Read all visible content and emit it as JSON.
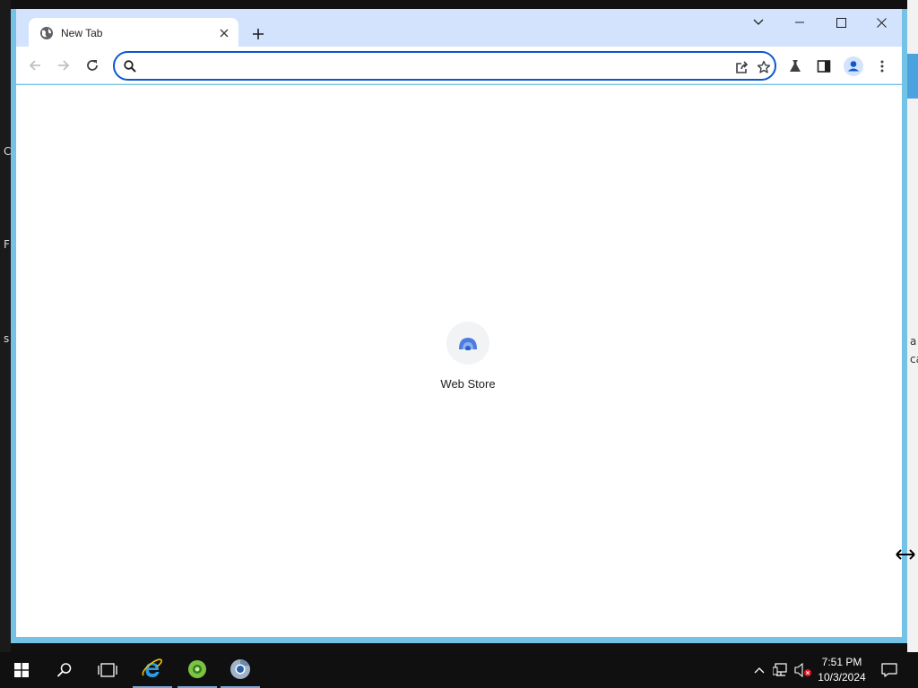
{
  "background": {
    "left_letters": [
      "C",
      "F",
      "s"
    ],
    "right_letters": [
      "a",
      "ca"
    ]
  },
  "browser": {
    "tab": {
      "title": "New Tab",
      "icon": "globe-icon"
    },
    "window_controls": [
      "tab-search",
      "minimize",
      "maximize",
      "close"
    ],
    "omnibox": {
      "value": "",
      "placeholder": ""
    },
    "accent_color": "#0b57d0",
    "titlebar_color": "#d3e3fd",
    "window_border_color": "#74c3e6"
  },
  "new_tab_page": {
    "shortcuts": [
      {
        "label": "Web Store",
        "icon": "web-store-icon"
      }
    ]
  },
  "taskbar": {
    "apps": [
      "start",
      "search",
      "task-view",
      "internet-explorer",
      "green-app",
      "chrome"
    ],
    "clock": {
      "time": "7:51 PM",
      "date": "10/3/2024"
    }
  }
}
